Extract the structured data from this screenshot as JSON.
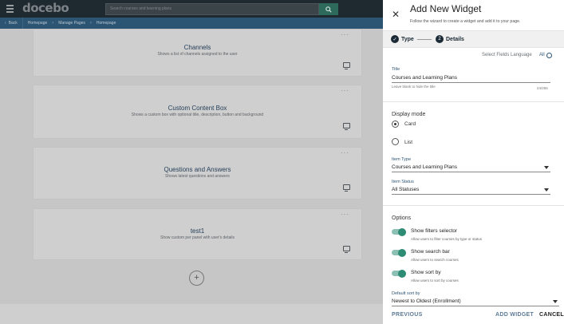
{
  "app": {
    "logo": "docebo",
    "search_placeholder": "Search courses and learning plans",
    "breadcrumbs": [
      "Back",
      "Homepage",
      "Manage Pages",
      "Homepage"
    ]
  },
  "widgets": [
    {
      "title": "Channels",
      "description": "Shows a list of channels assigned to the user"
    },
    {
      "title": "Custom Content Box",
      "description": "Shows a custom box with optional title, description, button and background"
    },
    {
      "title": "Questions and Answers",
      "description": "Shows latest questions and answers"
    },
    {
      "title": "test1",
      "description": "Show custom per panel with user's details"
    }
  ],
  "panel": {
    "title": "Add New Widget",
    "subtitle": "Follow the wizard to create a widget and add it to your page.",
    "steps": [
      {
        "number": "✓",
        "label": "Type"
      },
      {
        "number": "2",
        "label": "Details"
      }
    ],
    "select_fields_language": "Select Fields Language",
    "language_value": "All",
    "title_field": {
      "label": "Title",
      "value": "Courses and Learning Plans",
      "hint": "Leave blank to hide the title",
      "counter": "24/255"
    },
    "display_mode": {
      "label": "Display mode",
      "options": [
        "Card",
        "List"
      ],
      "selected": "Card"
    },
    "item_type": {
      "label": "Item Type",
      "value": "Courses and Learning Plans"
    },
    "item_status": {
      "label": "Item Status",
      "value": "All Statuses"
    },
    "options": {
      "label": "Options",
      "toggles": [
        {
          "label": "Show filters selector",
          "desc": "Allow users to filter courses by type or status",
          "on": true
        },
        {
          "label": "Show search bar",
          "desc": "Allow users to search courses",
          "on": true
        },
        {
          "label": "Show sort by",
          "desc": "Allow users to sort by courses",
          "on": true
        }
      ]
    },
    "default_sort": {
      "label": "Default sort by",
      "value": "Newest to Oldest (Enrollment)"
    },
    "footer": {
      "previous": "PREVIOUS",
      "add_widget": "ADD WIDGET",
      "cancel": "CANCEL"
    }
  },
  "colors": {
    "topbar": "#1f2a30",
    "breadcrumb_bar": "#2c5473",
    "toggle_on": "#2e8b74",
    "link": "#2c5473"
  }
}
